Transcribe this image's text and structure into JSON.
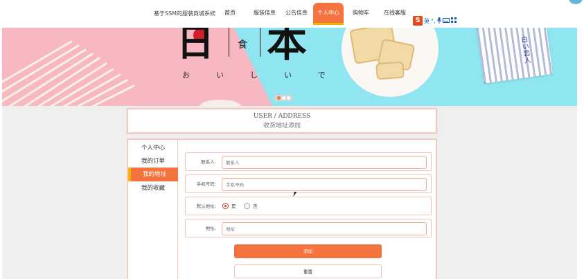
{
  "nav": {
    "site_title": "基于SSM的服装商城系统",
    "items": [
      {
        "label": "首页",
        "active": false
      },
      {
        "label": "服装信息",
        "active": false
      },
      {
        "label": "公告信息",
        "active": false
      },
      {
        "label": "个人中心",
        "active": true
      },
      {
        "label": "购物车",
        "active": false
      },
      {
        "label": "在线客服",
        "active": false
      }
    ],
    "accent_color": "#f4733f",
    "underline_color": "#f5b400"
  },
  "ime_toolbar": {
    "logo": "S",
    "mode": "英",
    "icons": [
      "punctuation-icon",
      "microphone-icon",
      "keyboard-icon",
      "grid-icon"
    ]
  },
  "banner": {
    "hanzi_left": "日",
    "hanzi_small": "食",
    "hanzi_right": "本",
    "kana": "おいしいです",
    "package_text": "白い恋人",
    "carousel": {
      "count": 3,
      "active_index": 0
    }
  },
  "page_header": {
    "en": "USER / ADDRESS",
    "cn": "收货地址添加"
  },
  "sidebar": {
    "items": [
      {
        "label": "个人中心",
        "active": false
      },
      {
        "label": "我的订单",
        "active": false
      },
      {
        "label": "我的地址",
        "active": true
      },
      {
        "label": "我的收藏",
        "active": false
      }
    ]
  },
  "form": {
    "contact": {
      "label": "联系人:",
      "placeholder": "联系人"
    },
    "phone": {
      "label": "手机号码:",
      "placeholder": "手机号码"
    },
    "default": {
      "label": "默认地址:",
      "options": [
        {
          "label": "是",
          "checked": true
        },
        {
          "label": "否",
          "checked": false
        }
      ]
    },
    "address": {
      "label": "地址:",
      "placeholder": "地址"
    },
    "submit_label": "添加",
    "reset_label": "重置"
  }
}
